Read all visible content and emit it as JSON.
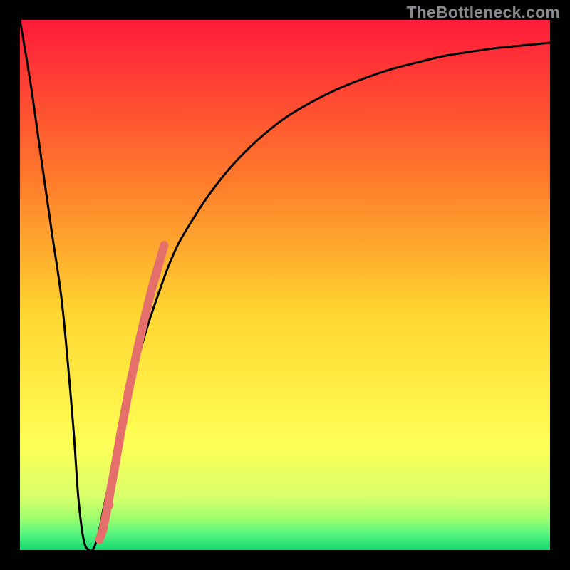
{
  "watermark": "TheBottleneck.com",
  "colors": {
    "bg_black": "#000000",
    "watermark_gray": "#888b8d",
    "gradient_top": "#ff1a3a",
    "gradient_mid_upper": "#ff7a2b",
    "gradient_mid": "#ffd530",
    "gradient_mid_lower": "#ffff55",
    "gradient_green_1": "#d8ff6a",
    "gradient_green_2": "#9fff6e",
    "gradient_green_3": "#55f57e",
    "gradient_bottom": "#15d870",
    "curve": "#000000",
    "dot": "#e56f6a"
  },
  "chart_data": {
    "type": "line",
    "title": "",
    "xlabel": "",
    "ylabel": "",
    "xlim": [
      0,
      100
    ],
    "ylim": [
      0,
      100
    ],
    "series": [
      {
        "name": "bottleneck-curve",
        "x": [
          0,
          2,
          4,
          6,
          8,
          10,
          11,
          12,
          13,
          14,
          15,
          16,
          18,
          20,
          22,
          24,
          26,
          28,
          30,
          33,
          36,
          40,
          45,
          50,
          55,
          60,
          65,
          70,
          75,
          80,
          85,
          90,
          95,
          100
        ],
        "values": [
          100,
          88,
          74,
          60,
          46,
          24,
          10,
          2,
          0,
          0.5,
          4,
          9,
          18,
          27,
          35,
          42,
          48,
          53.5,
          58,
          63,
          67.5,
          72.5,
          77.5,
          81.5,
          84.5,
          87,
          89,
          90.7,
          92,
          93.2,
          94,
          94.7,
          95.2,
          95.7
        ]
      }
    ],
    "highlight_band": {
      "name": "dot-segment",
      "x": [
        15.0,
        15.7,
        16.4,
        17.6,
        19.0,
        20.5,
        22.2,
        23.8,
        25.2,
        26.5,
        27.2
      ],
      "values": [
        2.0,
        4.0,
        7.5,
        14.0,
        22.0,
        30.0,
        38.0,
        45.0,
        50.5,
        55.0,
        57.5
      ]
    },
    "spot_dots": {
      "name": "isolated-dots",
      "x": [
        15.0,
        15.8,
        16.7
      ],
      "values": [
        2.0,
        4.5,
        8.5
      ]
    }
  }
}
